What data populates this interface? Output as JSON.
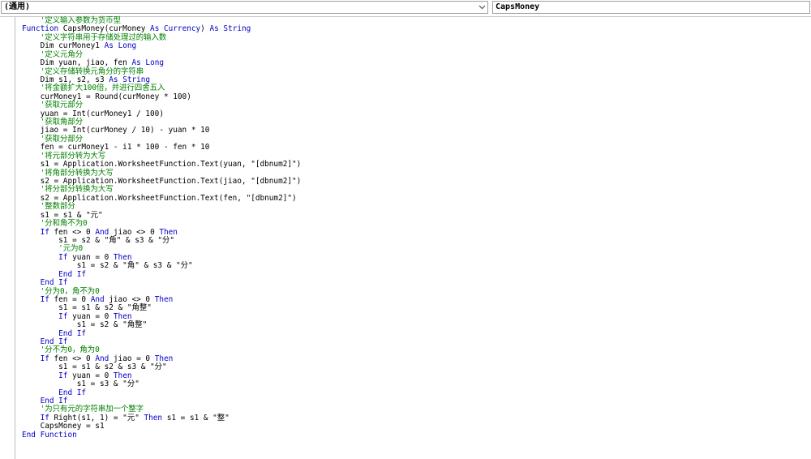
{
  "object_combo": {
    "value": "(通用)"
  },
  "procedure_combo": {
    "value": "CapsMoney"
  },
  "colors": {
    "keyword": "#0000c8",
    "comment": "#008000",
    "text": "#000000"
  },
  "icons": {
    "dropdown": "chevron-down-icon"
  },
  "code_lines": [
    [
      [
        "cm",
        "    '定义输入参数为货币型"
      ]
    ],
    [
      [
        "kw",
        "Function"
      ],
      [
        "tx",
        " CapsMoney(curMoney "
      ],
      [
        "kw",
        "As"
      ],
      [
        "tx",
        " "
      ],
      [
        "kw",
        "Currency"
      ],
      [
        "tx",
        ") "
      ],
      [
        "kw",
        "As"
      ],
      [
        "tx",
        " "
      ],
      [
        "kw",
        "String"
      ]
    ],
    [
      [
        "cm",
        "    '定义字符串用于存储处理过的输入数"
      ]
    ],
    [
      [
        "tx",
        "    Dim curMoney1 "
      ],
      [
        "kw",
        "As"
      ],
      [
        "tx",
        " "
      ],
      [
        "kw",
        "Long"
      ]
    ],
    [
      [
        "cm",
        "    '定义元角分"
      ]
    ],
    [
      [
        "tx",
        "    Dim yuan, jiao, fen "
      ],
      [
        "kw",
        "As"
      ],
      [
        "tx",
        " "
      ],
      [
        "kw",
        "Long"
      ]
    ],
    [
      [
        "cm",
        "    '定义存储转换元角分的字符串"
      ]
    ],
    [
      [
        "tx",
        "    Dim s1, s2, s3 "
      ],
      [
        "kw",
        "As"
      ],
      [
        "tx",
        " "
      ],
      [
        "kw",
        "String"
      ]
    ],
    [
      [
        "cm",
        "    '将金额扩大100倍，并进行四舍五入"
      ]
    ],
    [
      [
        "tx",
        "    curMoney1 = Round(curMoney * 100)"
      ]
    ],
    [
      [
        "cm",
        "    '获取元部分"
      ]
    ],
    [
      [
        "tx",
        "    yuan = Int(curMoney1 / 100)"
      ]
    ],
    [
      [
        "cm",
        "    '获取角部分"
      ]
    ],
    [
      [
        "tx",
        "    jiao = Int(curMoney / 10) - yuan * 10"
      ]
    ],
    [
      [
        "cm",
        "    '获取分部分"
      ]
    ],
    [
      [
        "tx",
        "    fen = curMoney1 - i1 * 100 - fen * 10"
      ]
    ],
    [
      [
        "cm",
        "    '将元部分转为大写"
      ]
    ],
    [
      [
        "tx",
        "    s1 = Application.WorksheetFunction.Text(yuan, \"[dbnum2]\")"
      ]
    ],
    [
      [
        "cm",
        "    '将角部分转换为大写"
      ]
    ],
    [
      [
        "tx",
        "    s2 = Application.WorksheetFunction.Text(jiao, \"[dbnum2]\")"
      ]
    ],
    [
      [
        "cm",
        "    '将分部分转换为大写"
      ]
    ],
    [
      [
        "tx",
        "    s2 = Application.WorksheetFunction.Text(fen, \"[dbnum2]\")"
      ]
    ],
    [
      [
        "cm",
        "    '整数部分"
      ]
    ],
    [
      [
        "tx",
        "    s1 = s1 & \"元\""
      ]
    ],
    [
      [
        "cm",
        "    '分和角不为0"
      ]
    ],
    [
      [
        "tx",
        "    "
      ],
      [
        "kw",
        "If"
      ],
      [
        "tx",
        " fen <> 0 "
      ],
      [
        "kw",
        "And"
      ],
      [
        "tx",
        " jiao <> 0 "
      ],
      [
        "kw",
        "Then"
      ]
    ],
    [
      [
        "tx",
        "        s1 = s2 & \"角\" & s3 & \"分\""
      ]
    ],
    [
      [
        "cm",
        "        '元为0"
      ]
    ],
    [
      [
        "tx",
        "        "
      ],
      [
        "kw",
        "If"
      ],
      [
        "tx",
        " yuan = 0 "
      ],
      [
        "kw",
        "Then"
      ]
    ],
    [
      [
        "tx",
        "            s1 = s2 & \"角\" & s3 & \"分\""
      ]
    ],
    [
      [
        "tx",
        "        "
      ],
      [
        "kw",
        "End If"
      ]
    ],
    [
      [
        "tx",
        "    "
      ],
      [
        "kw",
        "End If"
      ]
    ],
    [
      [
        "cm",
        "    '分为0，角不为0"
      ]
    ],
    [
      [
        "tx",
        "    "
      ],
      [
        "kw",
        "If"
      ],
      [
        "tx",
        " fen = 0 "
      ],
      [
        "kw",
        "And"
      ],
      [
        "tx",
        " jiao <> 0 "
      ],
      [
        "kw",
        "Then"
      ]
    ],
    [
      [
        "tx",
        "        s1 = s1 & s2 & \"角整\""
      ]
    ],
    [
      [
        "tx",
        "        "
      ],
      [
        "kw",
        "If"
      ],
      [
        "tx",
        " yuan = 0 "
      ],
      [
        "kw",
        "Then"
      ]
    ],
    [
      [
        "tx",
        "            s1 = s2 & \"角整\""
      ]
    ],
    [
      [
        "tx",
        "        "
      ],
      [
        "kw",
        "End If"
      ]
    ],
    [
      [
        "tx",
        "    "
      ],
      [
        "kw",
        "End If"
      ]
    ],
    [
      [
        "cm",
        "    '分不为0，角为0"
      ]
    ],
    [
      [
        "tx",
        "    "
      ],
      [
        "kw",
        "If"
      ],
      [
        "tx",
        " fen <> 0 "
      ],
      [
        "kw",
        "And"
      ],
      [
        "tx",
        " jiao = 0 "
      ],
      [
        "kw",
        "Then"
      ]
    ],
    [
      [
        "tx",
        "        s1 = s1 & s2 & s3 & \"分\""
      ]
    ],
    [
      [
        "tx",
        "        "
      ],
      [
        "kw",
        "If"
      ],
      [
        "tx",
        " yuan = 0 "
      ],
      [
        "kw",
        "Then"
      ]
    ],
    [
      [
        "tx",
        "            s1 = s3 & \"分\""
      ]
    ],
    [
      [
        "tx",
        "        "
      ],
      [
        "kw",
        "End If"
      ]
    ],
    [
      [
        "tx",
        "    "
      ],
      [
        "kw",
        "End If"
      ]
    ],
    [
      [
        "cm",
        "    '为只有元的字符串加一个整字"
      ]
    ],
    [
      [
        "tx",
        "    "
      ],
      [
        "kw",
        "If"
      ],
      [
        "tx",
        " Right(s1, 1) = \"元\" "
      ],
      [
        "kw",
        "Then"
      ],
      [
        "tx",
        " s1 = s1 & \"整\""
      ]
    ],
    [
      [
        "tx",
        "    CapsMoney = s1"
      ]
    ],
    [
      [
        "kw",
        "End Function"
      ]
    ]
  ]
}
